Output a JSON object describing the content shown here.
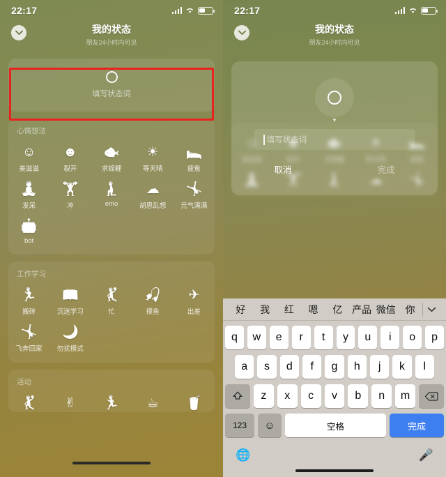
{
  "statusbar": {
    "time": "22:17",
    "signal_icon": "cellular-bars-icon",
    "wifi_icon": "wifi-icon",
    "battery_icon": "battery-icon"
  },
  "header": {
    "title": "我的状态",
    "subtitle": "朋友24小时内可见",
    "back_icon": "chevron-down-icon"
  },
  "entry_card": {
    "placeholder": "填写状态词",
    "ring_icon": "status-ring-icon"
  },
  "annotation": {
    "color": "#e8231f",
    "shape": "rectangle"
  },
  "sections": [
    {
      "title": "心情想法",
      "items": [
        {
          "label": "美滋滋",
          "icon": "smiley-face-icon",
          "glyph": "☺"
        },
        {
          "label": "裂开",
          "icon": "cracked-face-icon",
          "glyph": "☻"
        },
        {
          "label": "求锦鲤",
          "icon": "koi-fish-icon",
          "glyph": "🐟"
        },
        {
          "label": "等天晴",
          "icon": "sun-icon",
          "glyph": "☀"
        },
        {
          "label": "疲惫",
          "icon": "tired-person-icon",
          "glyph": "🛌"
        },
        {
          "label": "发呆",
          "icon": "daze-person-icon",
          "glyph": "🧘"
        },
        {
          "label": "冲",
          "icon": "charging-person-icon",
          "glyph": "🏋"
        },
        {
          "label": "emo",
          "icon": "emo-person-icon",
          "glyph": "🧎"
        },
        {
          "label": "胡思乱想",
          "icon": "thought-cloud-icon",
          "glyph": "☁"
        },
        {
          "label": "元气满满",
          "icon": "energetic-person-icon",
          "glyph": "🤸"
        },
        {
          "label": "bot",
          "icon": "robot-icon",
          "glyph": "🤖"
        }
      ]
    },
    {
      "title": "工作学习",
      "items": [
        {
          "label": "搬砖",
          "icon": "carrying-bricks-icon",
          "glyph": "🏃"
        },
        {
          "label": "沉迷学习",
          "icon": "studying-icon",
          "glyph": "📖"
        },
        {
          "label": "忙",
          "icon": "busy-person-icon",
          "glyph": "🤾"
        },
        {
          "label": "摸鱼",
          "icon": "slacking-icon",
          "glyph": "🎣"
        },
        {
          "label": "出差",
          "icon": "airplane-icon",
          "glyph": "✈"
        },
        {
          "label": "飞奔回家",
          "icon": "running-home-icon",
          "glyph": "🤸"
        },
        {
          "label": "勿扰模式",
          "icon": "crescent-moon-icon",
          "glyph": "🌙"
        }
      ]
    },
    {
      "title": "活动",
      "items": [
        {
          "label": "",
          "icon": "dancing-person-icon",
          "glyph": "🤾"
        },
        {
          "label": "",
          "icon": "victory-hand-icon",
          "glyph": "✌"
        },
        {
          "label": "",
          "icon": "running-person-icon",
          "glyph": "🏃"
        },
        {
          "label": "",
          "icon": "coffee-cup-icon",
          "glyph": "☕"
        },
        {
          "label": "",
          "icon": "bubble-tea-icon",
          "glyph": "🥤"
        }
      ]
    }
  ],
  "dialog": {
    "avatar_icon": "status-ring-icon",
    "caret_icon": "caret-down-icon",
    "input_placeholder": "填写状态词",
    "input_value": "",
    "cancel_label": "取消",
    "done_label": "完成"
  },
  "keyboard": {
    "predictions": [
      "好",
      "我",
      "红",
      "嗯",
      "亿",
      "产品",
      "微信",
      "你"
    ],
    "collapse_icon": "chevron-down-icon",
    "row1": [
      "q",
      "w",
      "e",
      "r",
      "t",
      "y",
      "u",
      "i",
      "o",
      "p"
    ],
    "row2": [
      "a",
      "s",
      "d",
      "f",
      "g",
      "h",
      "j",
      "k",
      "l"
    ],
    "row3": [
      "z",
      "x",
      "c",
      "v",
      "b",
      "n",
      "m"
    ],
    "shift_icon": "shift-up-icon",
    "backspace_icon": "backspace-icon",
    "numeric_label": "123",
    "emoji_icon": "smiley-emoji-icon",
    "space_label": "空格",
    "done_label": "完成",
    "done_color": "#3d7ef0",
    "globe_icon": "globe-icon",
    "mic_icon": "microphone-icon"
  }
}
